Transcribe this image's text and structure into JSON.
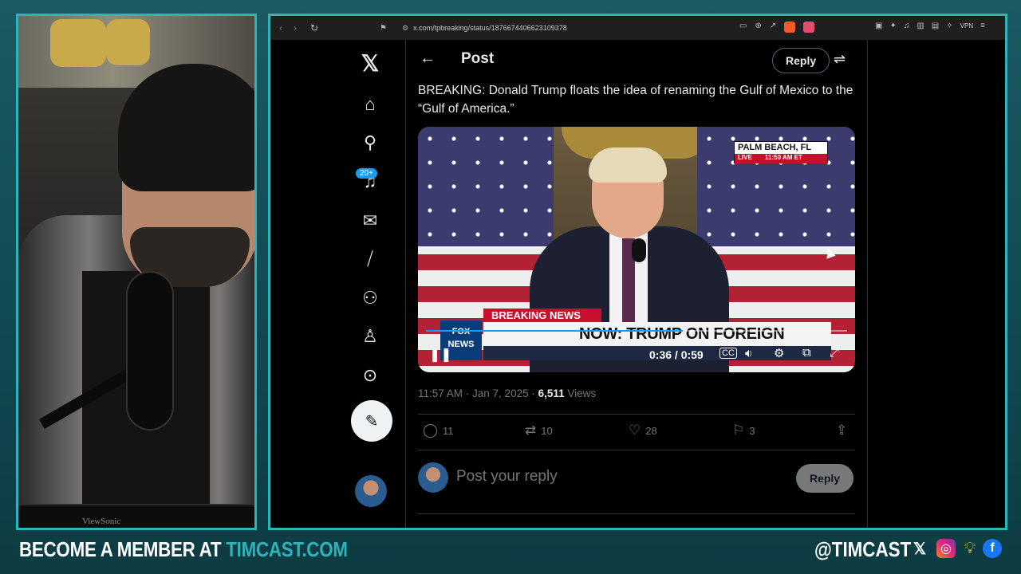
{
  "browser": {
    "url": "x.com/tpbreaking/status/1876674406623109378",
    "vpn_label": "VPN"
  },
  "nav": {
    "notifications_badge": "20+"
  },
  "post": {
    "header_title": "Post",
    "reply_top_label": "Reply",
    "text": "BREAKING: Donald Trump floats the idea of renaming the Gulf of Mexico to the “Gulf of America.”",
    "video": {
      "location": "PALM BEACH, FL",
      "live_label": "LIVE",
      "live_time": "11:50 AM ET",
      "breaking_tag": "BREAKING NEWS",
      "headline": "NOW: TRUMP ON FOREIGN POLICY",
      "network_logo": "FOX NEWS",
      "time_display": "0:36 / 0:59",
      "progress": 0.61
    },
    "timestamp": "11:57 AM · Jan 7, 2025 · ",
    "views_count": "6,511",
    "views_label": " Views",
    "actions": {
      "replies": "11",
      "reposts": "10",
      "likes": "28",
      "bookmarks": "3"
    },
    "reply_placeholder": "Post your reply",
    "reply_button": "Reply"
  },
  "webcam": {
    "monitor_brand": "ViewSonic"
  },
  "banner": {
    "left_prefix": "BECOME A MEMBER AT ",
    "left_site": "TIMCAST.COM",
    "handle": "@TIMCAST"
  },
  "colors": {
    "accent": "#2fb3b8",
    "link_blue": "#1d9bf0"
  }
}
